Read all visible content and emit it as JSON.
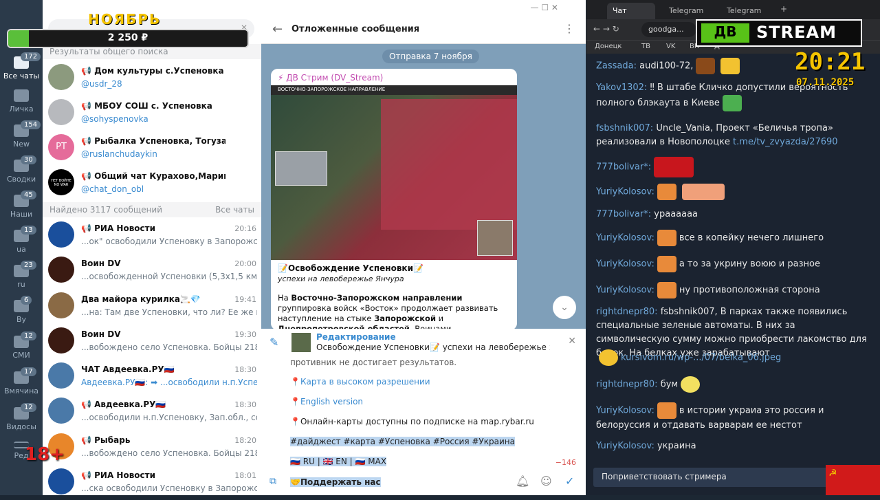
{
  "overlay": {
    "month": "НОЯБРЬ",
    "amount": "2 250 ₽",
    "age": "18+",
    "logo_left": "ДВ",
    "logo_right": "STREAM",
    "clock": "20:21",
    "date": "07.11.2025"
  },
  "folders": [
    {
      "label": "Все чаты",
      "badge": "172"
    },
    {
      "label": "Личка",
      "badge": ""
    },
    {
      "label": "New",
      "badge": "154"
    },
    {
      "label": "Сводки",
      "badge": "30"
    },
    {
      "label": "Наши",
      "badge": "45"
    },
    {
      "label": "ua",
      "badge": "13"
    },
    {
      "label": "ru",
      "badge": "23"
    },
    {
      "label": "By",
      "badge": "6"
    },
    {
      "label": "СМИ",
      "badge": "12"
    },
    {
      "label": "Вмячина",
      "badge": "17"
    },
    {
      "label": "Видосы",
      "badge": "12"
    },
    {
      "label": "Ред",
      "badge": ""
    }
  ],
  "search": {
    "section_global": "Результаты общего поиска",
    "section_found": "Найдено 3117 сообщений",
    "all_chats": "Все чаты"
  },
  "global": [
    {
      "title": "📢 Дом культуры с.Успеновка",
      "sub": "@usdr_28"
    },
    {
      "title": "📢 МБОУ СОШ с. Успеновка",
      "sub": "@sohyspenovka"
    },
    {
      "title": "📢 Рыбалка Успеновка, Тогузак.",
      "sub": "@ruslanchudaykin",
      "initials": "PT"
    },
    {
      "title": "📢 Общий чат Курахово,Маринка,Угледар,Ма...",
      "sub": "@chat_don_obl",
      "initials": "НЕТ ВОЙНЕ NO WAR"
    }
  ],
  "results": [
    {
      "title": "📢 РИА Новости",
      "time": "20:16",
      "sub": "...ок\" освободили Успеновку в Запорожской..."
    },
    {
      "title": "Воин DV",
      "time": "20:00",
      "sub": "...освобожденной Успеновки (5,3x1,5 км) и..."
    },
    {
      "title": "Два майора курилка🚬💎",
      "time": "19:41",
      "sub": "...на: Там две Успеновки, что ли? Ее же в апрел..."
    },
    {
      "title": "Воин DV",
      "time": "19:30",
      "sub": "...вобождено село Успеновка. Бойцы 218..."
    },
    {
      "title": "ЧАТ Авдеевка.РУ🇷🇺",
      "time": "18:30",
      "sub": "Авдеевка.РУ🇷🇺: ➡ ...освободили н.п.Успеновку, З..."
    },
    {
      "title": "📢 Авдеевка.РУ🇷🇺",
      "time": "18:30",
      "sub": "...освободили н.п.Успеновку, Зап.обл., сообщи..."
    },
    {
      "title": "📢 Рыбарь",
      "time": "18:20",
      "sub": "...вобождено село Успеновка. Бойцы 218 та..."
    },
    {
      "title": "📢 РИА Новости",
      "time": "18:01",
      "sub": "...ска освободили Успеновку в Запорожской..."
    }
  ],
  "chat": {
    "header": "Отложенные сообщения",
    "date_chip": "Отправка 7 ноября",
    "author": "⚡ ДВ Стрим (DV_Stream)",
    "map_title": "ВОСТОЧНО-ЗАПОРОЖСКОЕ НАПРАВЛЕНИЕ",
    "post_title": "📝Освобождение Успеновки📝",
    "post_sub": "успехи на левобережье Янчура",
    "post_p1a": "На ",
    "post_p1b": "Восточно-Запорожском направлении",
    "post_p1c": " группировка войск «Восток» продолжает развивать наступление на стыке ",
    "post_p1d": "Запорожской",
    "post_p1e": " и ",
    "post_p1f": "Днепропетровской областей",
    "post_p1g": ". Воинами-"
  },
  "edit": {
    "label": "Редактирование",
    "preview": "Освобождение Успеновки📝 успехи на левобережье Янчура ...",
    "l0": "противник не достигает результатов.",
    "l1": "📍Карта в высоком разрешении",
    "l2": "📍English version",
    "l3": "📍Онлайн-карты доступны по подписке на map.rybar.ru",
    "l4": "#дайджест #карта #Успеновка #Россия #Украина",
    "l5": "🇷🇺 RU | 🇬🇧 EN | 🇷🇺 MAX",
    "counter": "−146",
    "l6": "🤝Поддержать нас"
  },
  "browser": {
    "tabs": [
      "Чат",
      "Telegram",
      "Telegram"
    ],
    "url": "goodga...",
    "bookmarks": [
      "Донецк",
      "ТВ",
      "VK",
      "ВК",
      "Д"
    ]
  },
  "stream_chat": [
    {
      "nick": "Zassada:",
      "text": "audi100-72,"
    },
    {
      "nick": "Yakov1302:",
      "text": "‼ В штабе Кличко допустили вероятность полного блэкаута в Киеве"
    },
    {
      "nick": "fsbshnik007:",
      "text": "Uncle_Vania, Проект «Беличья тропа» реализовали в Новополоцке ",
      "link": "t.me/tv_zvyazda/27690"
    },
    {
      "nick": "777bolivar*:",
      "text": ""
    },
    {
      "nick": "YuriyKolosov:",
      "text": ""
    },
    {
      "nick": "777bolivar*:",
      "text": "ураааааа"
    },
    {
      "nick": "YuriyKolosov:",
      "text": "все в копейку нечего лишнего"
    },
    {
      "nick": "YuriyKolosov:",
      "text": "а то за укрину воюю и разное"
    },
    {
      "nick": "YuriyKolosov:",
      "text": "ну противоположная сторона"
    },
    {
      "nick": "rightdnepr80:",
      "text": "fsbshnik007, В парках также появились специальные зеленые автоматы. В них за символическую сумму можно приобрести лакомство для белок. На белках уже зарабатывают"
    },
    {
      "nick": "",
      "link": "kursivom.ru/wp-.../07/belka_06.jpeg"
    },
    {
      "nick": "rightdnepr80:",
      "text": "бум"
    },
    {
      "nick": "YuriyKolosov:",
      "text": "в истории украиа это россия и белоруссия и отдавать варварам ее нестот"
    },
    {
      "nick": "YuriyKolosov:",
      "text": "украина"
    }
  ],
  "greet_button": "Поприветствовать стримера"
}
